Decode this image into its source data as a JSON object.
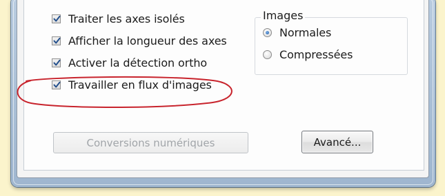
{
  "options": {
    "items": [
      {
        "label": "Traiter les axes isolés",
        "checked": true
      },
      {
        "label": "Afficher la longueur des axes",
        "checked": true
      },
      {
        "label": "Activer la détection ortho",
        "checked": true
      },
      {
        "label": "Travailler en flux d'images",
        "checked": true
      }
    ]
  },
  "images_group": {
    "title": "Images",
    "options": [
      {
        "label": "Normales",
        "selected": true
      },
      {
        "label": "Compressées",
        "selected": false
      }
    ]
  },
  "buttons": {
    "conversions_label": "Conversions numériques",
    "advanced_label": "Avancé..."
  },
  "colors": {
    "background": "#fbf4cc",
    "highlight": "#c8232c",
    "radio_selected": "#1e5aa6"
  }
}
